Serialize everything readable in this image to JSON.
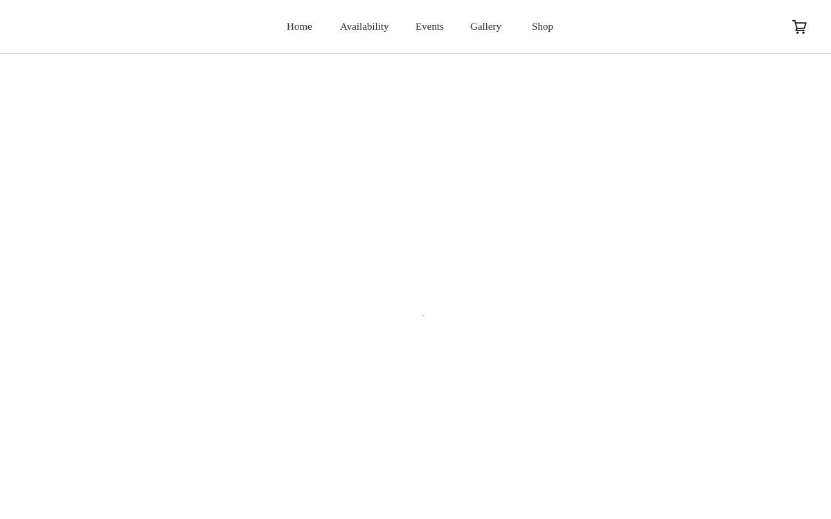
{
  "header": {
    "nav": {
      "home": "Home",
      "availability": "Availability",
      "events": "Events",
      "gallery": "Gallery",
      "shop": "Shop"
    },
    "cart": {
      "icon": "shopping-cart-icon"
    }
  },
  "colors": {
    "background": "#ffffff",
    "nav_text": "#2b2b2b",
    "header_border": "#dcdcdc",
    "icon": "#1a1a1a"
  },
  "main": {
    "loading_indicator": "spinner-dot"
  }
}
